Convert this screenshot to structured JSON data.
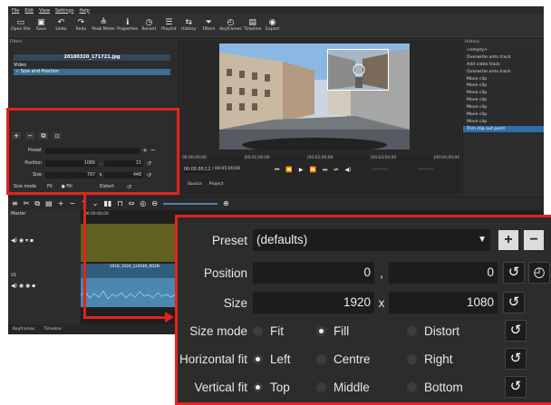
{
  "menu": [
    "File",
    "Edit",
    "View",
    "Settings",
    "Help"
  ],
  "toolbar": [
    {
      "icon": "open-file-icon",
      "glyph": "▭",
      "label": "Open File"
    },
    {
      "icon": "save-icon",
      "glyph": "▣",
      "label": "Save"
    },
    {
      "icon": "undo-icon",
      "glyph": "↶",
      "label": "Undo"
    },
    {
      "icon": "redo-icon",
      "glyph": "↷",
      "label": "Redo"
    },
    {
      "icon": "peak-meter-icon",
      "glyph": "≜",
      "label": "Peak Meter"
    },
    {
      "icon": "properties-icon",
      "glyph": "ℹ",
      "label": "Properties"
    },
    {
      "icon": "recent-icon",
      "glyph": "◷",
      "label": "Recent"
    },
    {
      "icon": "playlist-icon",
      "glyph": "☰",
      "label": "Playlist"
    },
    {
      "icon": "history-icon",
      "glyph": "⇆",
      "label": "History"
    },
    {
      "icon": "filters-icon",
      "glyph": "⏷",
      "label": "Filters"
    },
    {
      "icon": "keyframes-icon",
      "glyph": "◴",
      "label": "Keyframes"
    },
    {
      "icon": "timeline-icon",
      "glyph": "▤",
      "label": "Timeline"
    },
    {
      "icon": "export-icon",
      "glyph": "◉",
      "label": "Export"
    }
  ],
  "filters": {
    "title": "Filters",
    "file_name": "20180320_171721.jpg",
    "section": "Video",
    "selected_filter": "✓ Size and Position",
    "preset_label": "Preset",
    "position_label": "Position",
    "position_x": "1089",
    "position_y": "15",
    "size_label": "Size",
    "size_w": "797",
    "size_h": "448",
    "size_mode_label": "Size mode",
    "fit": "Fit",
    "fill": "Fill",
    "distort": "Distort"
  },
  "history": {
    "title": "History",
    "items": [
      "<empty>",
      "Overwrite onto track",
      "Add video track",
      "Overwrite onto track",
      "Move clip",
      "Move clip",
      "Move clip",
      "Move clip",
      "Move clip",
      "Move clip",
      "Move clip",
      "Trim clip out point"
    ],
    "selected_index": 11
  },
  "viewer": {
    "ruler": [
      "00:00:00;00",
      "|00:01;00:00",
      "|00:02;00:00",
      "|00:03;00:00",
      "|00:04;00:00"
    ],
    "timecode": "00:00:00;12",
    "duration": "/ 00:05:00;00",
    "in_out": "--:--:--:--",
    "source_tab": "Source",
    "project_tab": "Project"
  },
  "timeline": {
    "master_label": "Master",
    "v1_label": "V1",
    "clip_label": "2018_1024_124546_002N",
    "ruler_start": "00:00:00;00",
    "tabs": [
      "Keyframes",
      "Timeline"
    ]
  },
  "zoom": {
    "preset_label": "Preset",
    "preset_value": "(defaults)",
    "position_label": "Position",
    "position_x": "0",
    "position_y": "0",
    "size_label": "Size",
    "size_w": "1920",
    "size_x_sep": "x",
    "size_h": "1080",
    "comma": ",",
    "size_mode_label": "Size mode",
    "size_mode": {
      "fit": "Fit",
      "fill": "Fill",
      "distort": "Distort",
      "selected": "Fill"
    },
    "hfit_label": "Horizontal fit",
    "hfit": {
      "left": "Left",
      "centre": "Centre",
      "right": "Right",
      "selected": "Left"
    },
    "vfit_label": "Vertical fit",
    "vfit": {
      "top": "Top",
      "middle": "Middle",
      "bottom": "Bottom",
      "selected": "Top"
    }
  },
  "colors": {
    "highlight": "#e0241c",
    "selection": "#2f6ea8",
    "track_video": "#606020",
    "clip_audio": "#4b87b0"
  }
}
